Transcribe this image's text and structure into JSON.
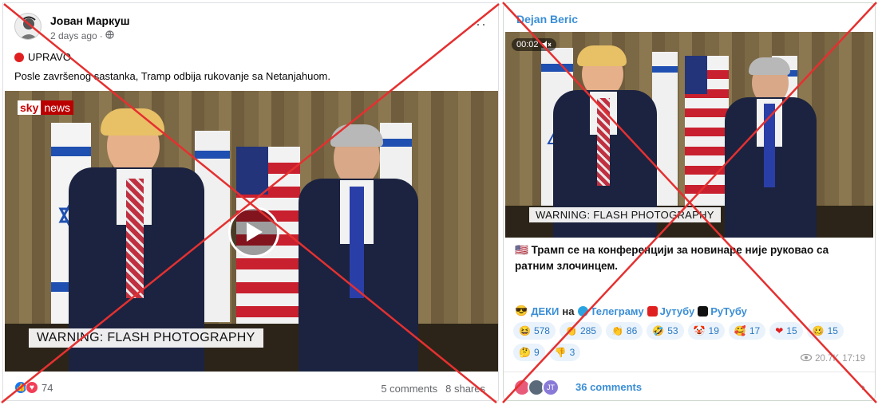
{
  "facebook": {
    "author": "Јован Маркуш",
    "time": "2 days ago",
    "badge": "UPRAVO",
    "caption": "Posle završenog sastanka, Tramp odbija rukovanje sa Netanjahuom.",
    "video": {
      "logo_a": "sky",
      "logo_b": "news",
      "warning": "WARNING: FLASH PHOTOGRAPHY"
    },
    "reaction_count": "74",
    "comments": "5 comments",
    "shares": "8 shares"
  },
  "telegram": {
    "author": "Dejan Beric",
    "video_time": "00:02",
    "warning": "WARNING: FLASH PHOTOGRAPHY",
    "text": "Трамп се на конференцији за новинаре није руковао са ратним злочинцем.",
    "channels": {
      "prefix": "ДЕКИ",
      "on": "на",
      "telegram": "Телеграму",
      "youtube": "Јутубу",
      "rutube": "РуТубу"
    },
    "reactions": [
      {
        "emoji": "😆",
        "count": "578"
      },
      {
        "emoji": "👏",
        "count": "285"
      },
      {
        "emoji": "👏",
        "count": "86"
      },
      {
        "emoji": "🤣",
        "count": "53"
      },
      {
        "emoji": "🤡",
        "count": "19"
      },
      {
        "emoji": "🥰",
        "count": "17"
      },
      {
        "emoji": "❤",
        "count": "15"
      },
      {
        "emoji": "🥴",
        "count": "15"
      },
      {
        "emoji": "🤔",
        "count": "9"
      },
      {
        "emoji": "👎",
        "count": "3"
      }
    ],
    "views": "20.7K",
    "post_time": "17:19",
    "comment_avatar_initials": "JT",
    "comments_label": "36 comments"
  },
  "colors": {
    "cross": "#e53030",
    "telegram_link": "#3a8ed6",
    "facebook_like": "#1877f2"
  }
}
